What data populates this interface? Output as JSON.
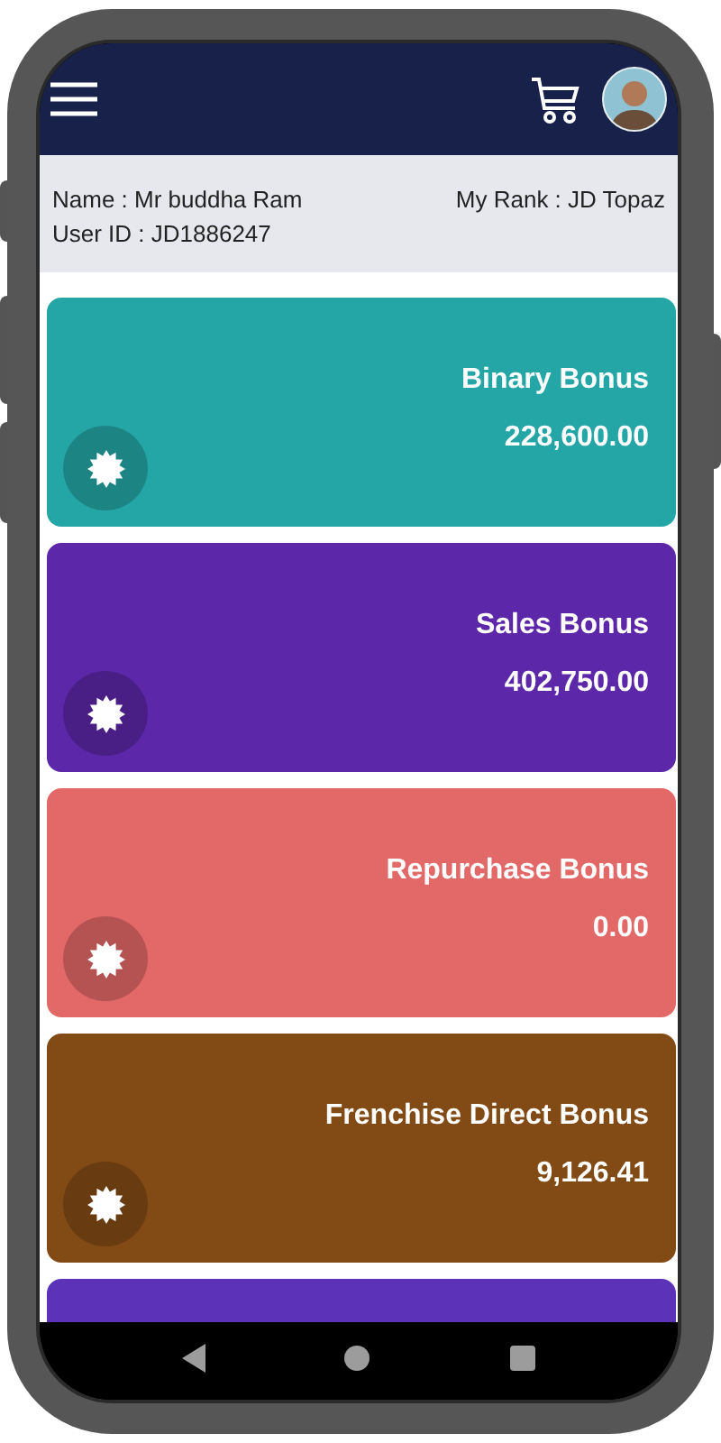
{
  "profile": {
    "name": "Name : Mr buddha Ram",
    "user_id": "User ID : JD1886247",
    "rank": "My Rank : JD Topaz"
  },
  "cards": [
    {
      "title": "Binary Bonus",
      "amount": "228,600.00",
      "color": "#25a6a6"
    },
    {
      "title": "Sales Bonus",
      "amount": "402,750.00",
      "color": "#5c27a8"
    },
    {
      "title": "Repurchase Bonus",
      "amount": "0.00",
      "color": "#e36868"
    },
    {
      "title": "Frenchise Direct Bonus",
      "amount": "9,126.41",
      "color": "#824a15"
    },
    {
      "color": "#5c33b8"
    }
  ]
}
